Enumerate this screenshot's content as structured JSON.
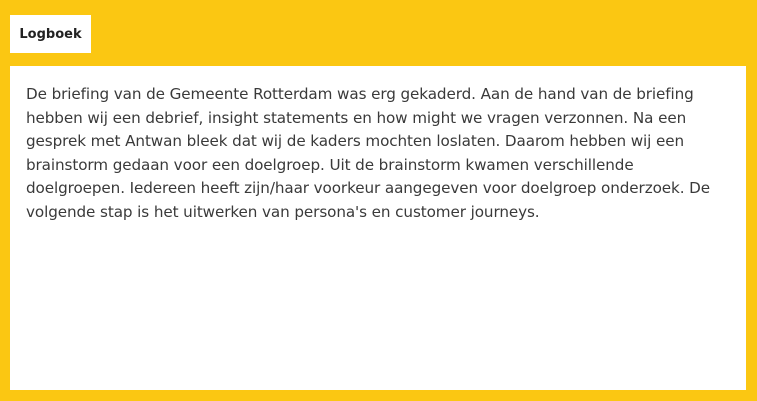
{
  "tab": {
    "label": "Logboek"
  },
  "content": {
    "text": "De briefing van de Gemeente Rotterdam was erg gekaderd. Aan de hand van de briefing hebben wij een debrief, insight statements en how might we vragen verzonnen. Na een gesprek met Antwan bleek dat wij de kaders mochten loslaten. Daarom hebben wij een brainstorm gedaan voor een doelgroep. Uit de brainstorm kwamen verschillende doelgroepen. Iedereen heeft zijn/haar voorkeur aangegeven voor doelgroep onderzoek. De volgende stap is het uitwerken van persona's en customer journeys."
  },
  "colors": {
    "background": "#fbc712",
    "panel": "#ffffff",
    "text": "#3a3a3a"
  }
}
